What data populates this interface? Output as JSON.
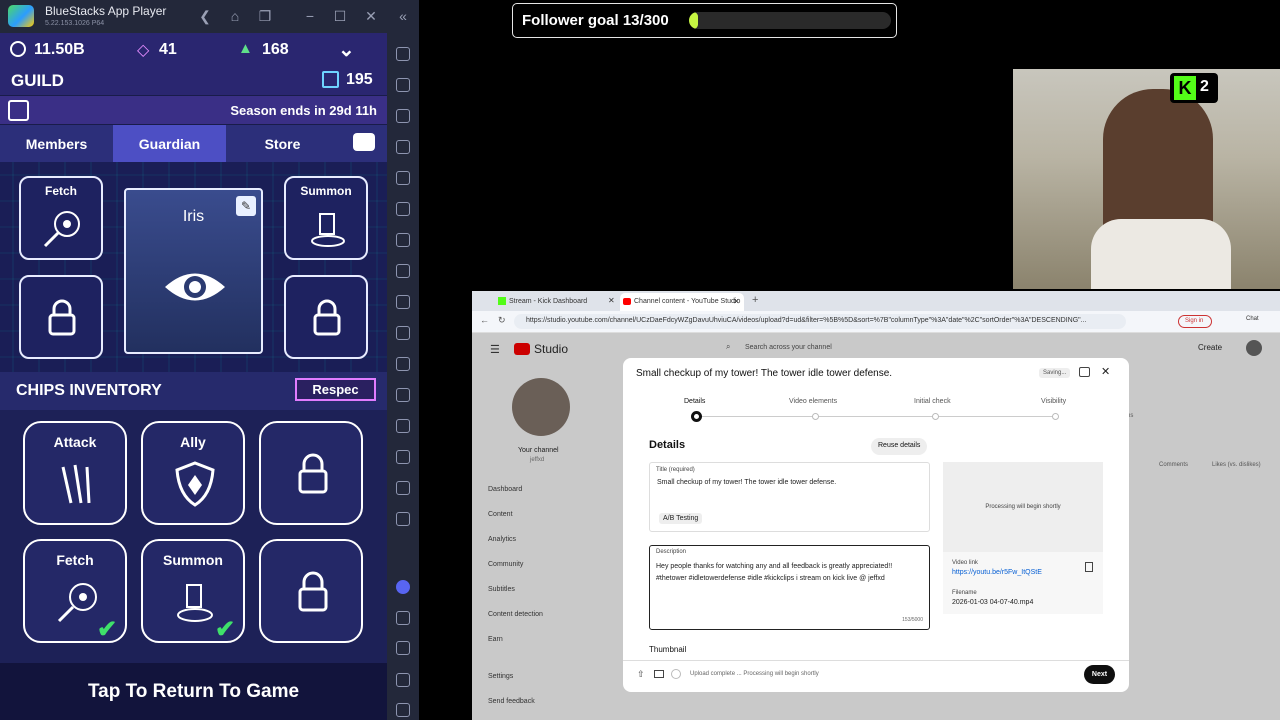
{
  "bluestacks": {
    "title": "BlueStacks App Player",
    "version": "5.22.153.1026  P64"
  },
  "game": {
    "coins": "11.50B",
    "gems": "41",
    "tickets": "168",
    "guild_label": "GUILD",
    "tokens": "195",
    "season": "Season ends in 29d 11h",
    "tabs": [
      "Members",
      "Guardian",
      "Store"
    ],
    "guardian": {
      "fetch": "Fetch",
      "summon": "Summon",
      "name": "Iris"
    },
    "chips_title": "CHIPS INVENTORY",
    "respec": "Respec",
    "chips": [
      "Attack",
      "Ally",
      "Fetch",
      "Summon"
    ],
    "tap": "Tap To Return To Game"
  },
  "overlay": {
    "follower_goal": "Follower goal 13/300",
    "follower_progress": 0.043,
    "badge": "2"
  },
  "browser": {
    "tab1": "Stream - Kick Dashboard",
    "tab2": "Channel content - YouTube Studio",
    "url": "https://studio.youtube.com/channel/UCzDaeFdcyWZgDavuUhviuCA/videos/upload?d=ud&filter=%5B%5D&sort=%7B\"columnType\"%3A\"date\"%2C\"sortOrder\"%3A\"DESCENDING\"...",
    "sign_in": "Sign in",
    "chat": "Chat",
    "studio": "Studio",
    "search_ph": "Search across your channel",
    "create": "Create",
    "your_channel": "Your channel",
    "handle": "jeffxd",
    "nav": [
      "Dashboard",
      "Content",
      "Analytics",
      "Community",
      "Subtitles",
      "Content detection",
      "Earn",
      "Settings",
      "Send feedback"
    ],
    "bg_cols": [
      "Comments",
      "Likes (vs. dislikes)"
    ],
    "bg_letters": "ns"
  },
  "modal": {
    "title": "Small checkup of my tower! The tower idle tower defense.",
    "saving": "Saving...",
    "steps": [
      "Details",
      "Video elements",
      "Initial check",
      "Visibility"
    ],
    "details": "Details",
    "reuse": "Reuse details",
    "title_label": "Title (required)",
    "title_value": "Small checkup of my tower! The tower idle tower defense.",
    "ab": "A/B Testing",
    "desc_label": "Description",
    "desc_value": "Hey people thanks for watching any and all feedback is greatly appreciated!! #thetower #idletowerdefense #idle #kickclips i stream on kick live @ jeffxd",
    "counter": "153/5000",
    "processing": "Processing will begin shortly",
    "video_link_label": "Video link",
    "video_link": "https://youtu.be/r5Fw_ItQStE",
    "filename_label": "Filename",
    "filename": "2026-01-03 04-07-40.mp4",
    "thumbnail": "Thumbnail",
    "footer_status": "Upload complete ... Processing will begin shortly",
    "next": "Next"
  },
  "colors": {
    "accent": "#3ea6ff",
    "game_bg": "#191c4a",
    "progress": "#c5f542"
  }
}
